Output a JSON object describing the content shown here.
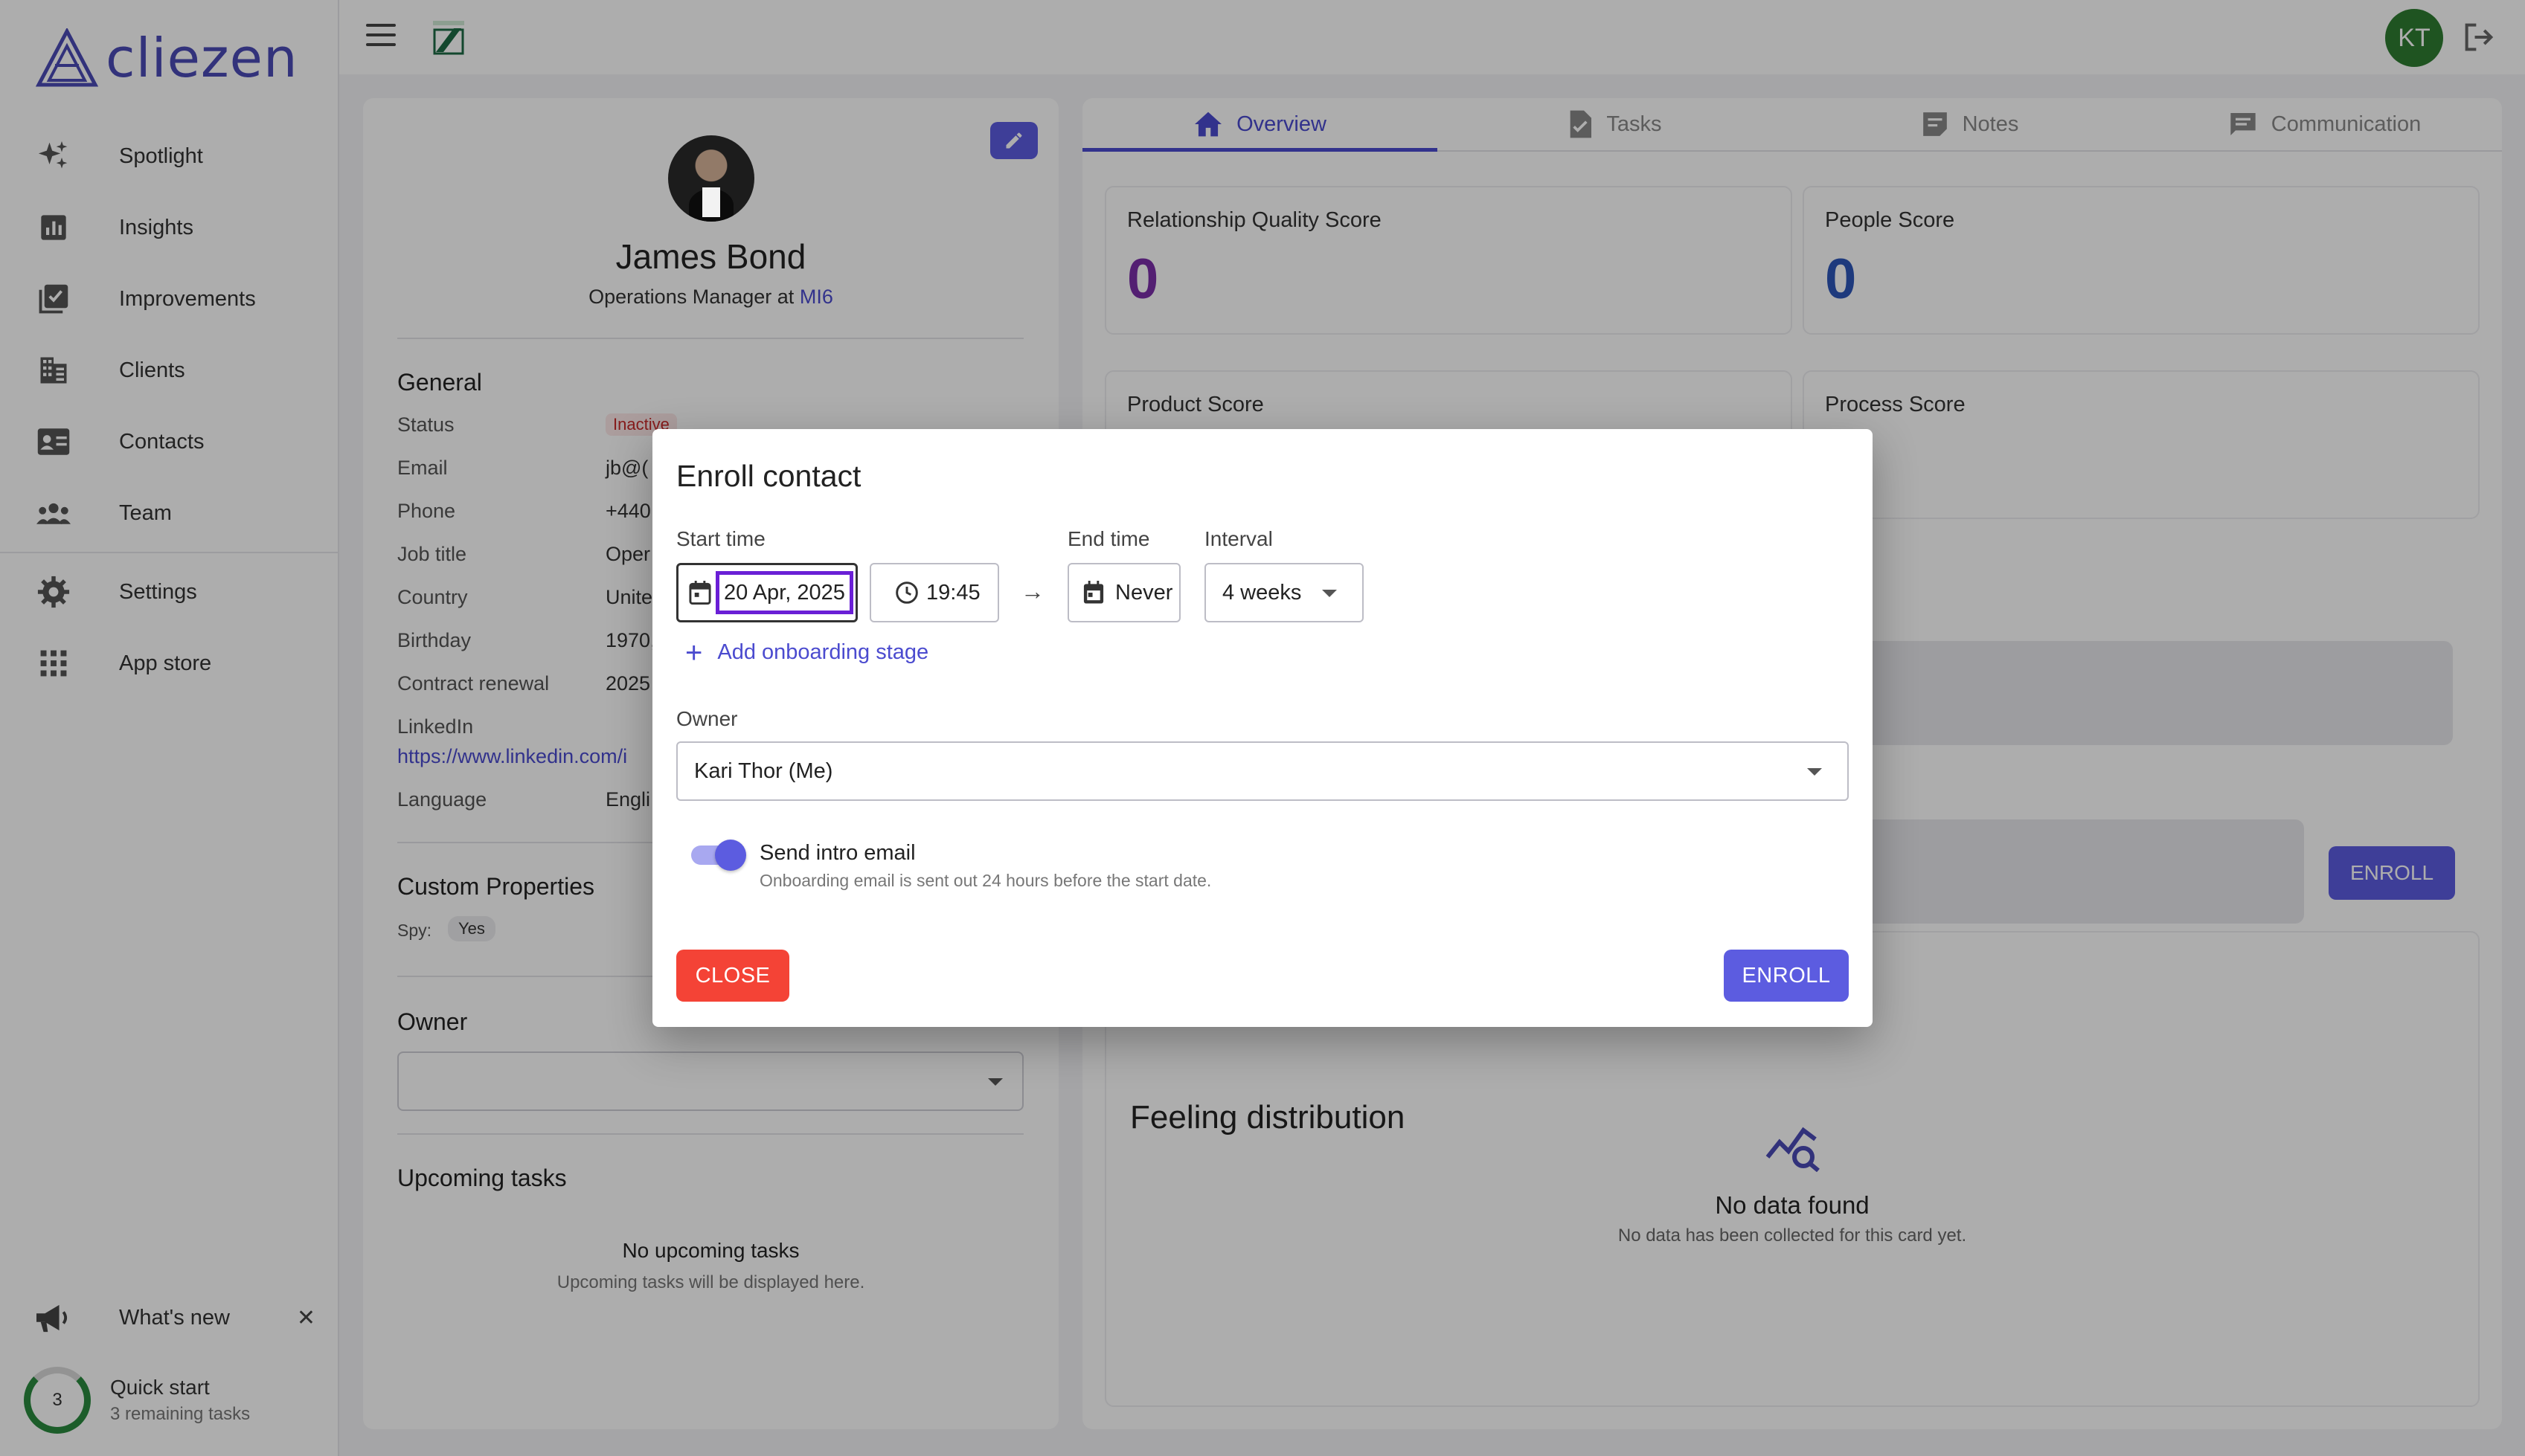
{
  "app": {
    "name": "cliezen"
  },
  "sidebar": {
    "items": [
      {
        "label": "Spotlight",
        "icon": "sparkle-icon"
      },
      {
        "label": "Insights",
        "icon": "chart-icon"
      },
      {
        "label": "Improvements",
        "icon": "checklist-icon"
      },
      {
        "label": "Clients",
        "icon": "building-icon"
      },
      {
        "label": "Contacts",
        "icon": "contact-card-icon"
      },
      {
        "label": "Team",
        "icon": "team-icon"
      },
      {
        "label": "Settings",
        "icon": "gear-icon"
      },
      {
        "label": "App store",
        "icon": "grid-icon"
      }
    ],
    "whats_new": "What's new",
    "quick_start": {
      "title": "Quick start",
      "subtitle": "3 remaining tasks",
      "count": "3"
    }
  },
  "topbar": {
    "avatar_initials": "KT"
  },
  "profile": {
    "name": "James Bond",
    "role_prefix": "Operations Manager at",
    "company": "MI6",
    "general_title": "General",
    "fields": {
      "status_label": "Status",
      "status_value": "Inactive",
      "email_label": "Email",
      "email_value": "jb@(",
      "phone_label": "Phone",
      "phone_value": "+440",
      "job_title_label": "Job title",
      "job_title_value": "Oper",
      "country_label": "Country",
      "country_value": "Unite",
      "birthday_label": "Birthday",
      "birthday_value": "1970,",
      "contract_label": "Contract renewal",
      "contract_value": "2025",
      "linkedin_label": "LinkedIn",
      "linkedin_value": "https://www.linkedin.com/i",
      "language_label": "Language",
      "language_value": "Engli"
    },
    "custom_title": "Custom Properties",
    "spy_label": "Spy:",
    "spy_value": "Yes",
    "owner_title": "Owner",
    "upcoming_title": "Upcoming tasks",
    "no_tasks_title": "No upcoming tasks",
    "no_tasks_sub": "Upcoming tasks will be displayed here."
  },
  "tabs": [
    {
      "label": "Overview",
      "icon": "home-icon"
    },
    {
      "label": "Tasks",
      "icon": "task-icon"
    },
    {
      "label": "Notes",
      "icon": "notes-icon"
    },
    {
      "label": "Communication",
      "icon": "chat-icon"
    }
  ],
  "scores": {
    "relationship_label": "Relationship Quality Score",
    "relationship_value": "0",
    "people_label": "People Score",
    "people_value": "0",
    "product_label": "Product Score",
    "process_label": "Process Score"
  },
  "background_enroll": "ENROLL",
  "feeling_title": "Feeling distribution",
  "no_data": {
    "title": "No data found",
    "subtitle": "No data has been collected for this card yet."
  },
  "modal": {
    "title": "Enroll contact",
    "start_label": "Start time",
    "start_date": "20 Apr, 2025",
    "start_time": "19:45",
    "end_label": "End time",
    "end_value": "Never",
    "interval_label": "Interval",
    "interval_value": "4 weeks",
    "add_stage": "Add onboarding stage",
    "owner_label": "Owner",
    "owner_value": "Kari Thor (Me)",
    "toggle_title": "Send intro email",
    "toggle_sub": "Onboarding email is sent out 24 hours before the start date.",
    "close": "CLOSE",
    "enroll": "ENROLL"
  },
  "colors": {
    "accent": "#5c5ce0",
    "danger": "#f44336",
    "score_purple": "#7b2fa8",
    "score_blue": "#2d56b8"
  }
}
